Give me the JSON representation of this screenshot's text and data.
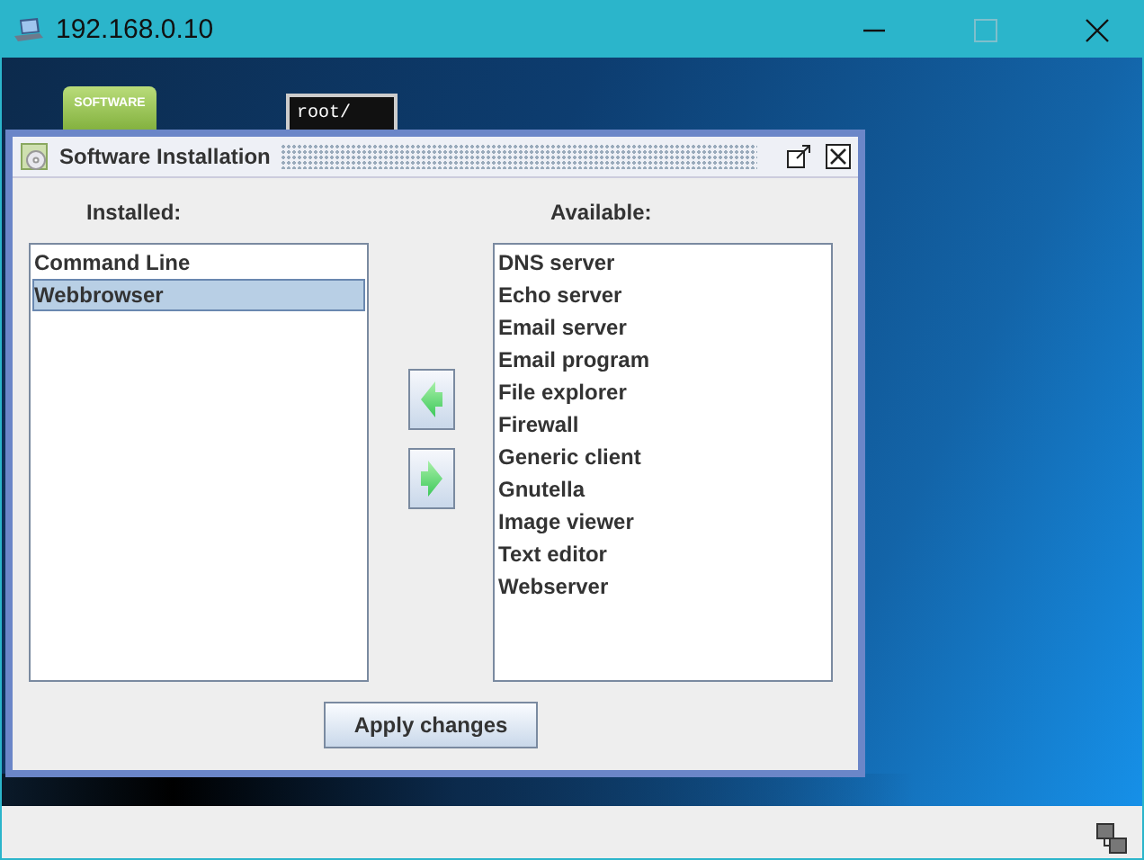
{
  "window": {
    "title": "192.168.0.10"
  },
  "desktop_icons": [
    {
      "kind": "software",
      "label": "SOFTWARE"
    },
    {
      "kind": "terminal",
      "label": "root/"
    }
  ],
  "dialog": {
    "title": "Software Installation",
    "installed": {
      "heading": "Installed:",
      "items": [
        {
          "label": "Command Line",
          "selected": false
        },
        {
          "label": "Webbrowser",
          "selected": true
        }
      ]
    },
    "available": {
      "heading": "Available:",
      "items": [
        {
          "label": "DNS server",
          "selected": false
        },
        {
          "label": "Echo server",
          "selected": false
        },
        {
          "label": "Email server",
          "selected": false
        },
        {
          "label": "Email program",
          "selected": false
        },
        {
          "label": "File explorer",
          "selected": false
        },
        {
          "label": "Firewall",
          "selected": false
        },
        {
          "label": "Generic client",
          "selected": false
        },
        {
          "label": "Gnutella",
          "selected": false
        },
        {
          "label": "Image viewer",
          "selected": false
        },
        {
          "label": "Text editor",
          "selected": false
        },
        {
          "label": "Webserver",
          "selected": false
        }
      ]
    },
    "apply_button": "Apply changes"
  }
}
